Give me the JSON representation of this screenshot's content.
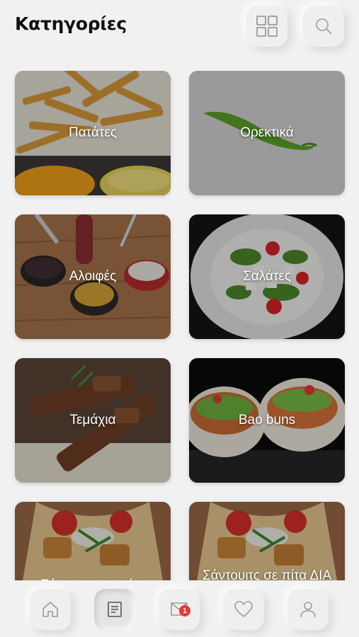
{
  "header": {
    "title": "Κατηγορίες"
  },
  "categories": [
    {
      "label": "Πατάτες"
    },
    {
      "label": "Ορεκτικά"
    },
    {
      "label": "Αλοιφές"
    },
    {
      "label": "Σαλάτες"
    },
    {
      "label": "Τεμάχια"
    },
    {
      "label": "Bao buns"
    },
    {
      "label": "Σάντουιτς σε πίτα"
    },
    {
      "label": "Σάντουιτς σε πίτα ΔΙΑ ΧΟΙΡΟΣ"
    }
  ],
  "bottom_nav": {
    "items": [
      {
        "icon": "home-icon"
      },
      {
        "icon": "menu-icon",
        "active": true
      },
      {
        "icon": "cart-icon",
        "badge": "1"
      },
      {
        "icon": "heart-icon"
      },
      {
        "icon": "user-icon"
      }
    ]
  },
  "colors": {
    "background": "#f1f1f1",
    "badge": "#e53935"
  }
}
